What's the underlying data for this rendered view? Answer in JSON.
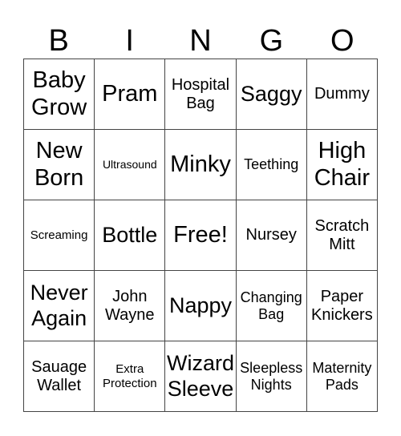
{
  "header": {
    "letters": [
      "B",
      "I",
      "N",
      "G",
      "O"
    ]
  },
  "cells": [
    "Baby Grow",
    "Pram",
    "Hospital Bag",
    "Saggy",
    "Dummy",
    "New Born",
    "Ultrasound",
    "Minky",
    "Teething",
    "High Chair",
    "Screaming",
    "Bottle",
    "Free!",
    "Nursey",
    "Scratch Mitt",
    "Never Again",
    "John Wayne",
    "Nappy",
    "Changing Bag",
    "Paper Knickers",
    "Sauage Wallet",
    "Extra Protection",
    "Wizard Sleeve",
    "Sleepless Nights",
    "Maternity Pads"
  ]
}
